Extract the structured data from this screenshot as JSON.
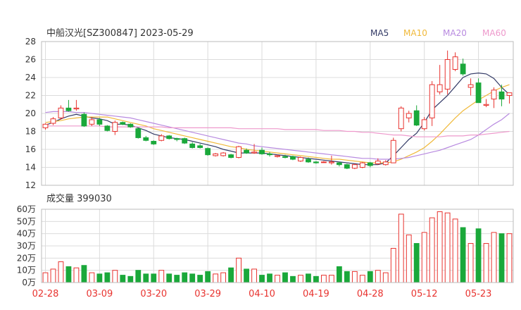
{
  "header": {
    "stock_title": "中船汉光[SZ300847] 2023-05-29",
    "volume_title": "成交量 399030"
  },
  "legend": [
    {
      "label": "MA5",
      "color": "#333a66"
    },
    {
      "label": "MA10",
      "color": "#f0b93a"
    },
    {
      "label": "MA20",
      "color": "#b88ae0"
    },
    {
      "label": "MA60",
      "color": "#ee99cc"
    }
  ],
  "colors": {
    "up": "#e8332f",
    "down": "#1aa83a",
    "grid": "#dcdcdc",
    "axis": "#666666"
  },
  "chart_data": [
    {
      "type": "candlestick",
      "x": [
        "02-28",
        "03-01",
        "03-02",
        "03-03",
        "03-06",
        "03-07",
        "03-08",
        "03-09",
        "03-10",
        "03-13",
        "03-14",
        "03-15",
        "03-16",
        "03-17",
        "03-20",
        "03-21",
        "03-22",
        "03-23",
        "03-24",
        "03-27",
        "03-28",
        "03-29",
        "03-30",
        "03-31",
        "04-03",
        "04-04",
        "04-06",
        "04-07",
        "04-10",
        "04-11",
        "04-12",
        "04-13",
        "04-14",
        "04-17",
        "04-18",
        "04-19",
        "04-20",
        "04-21",
        "04-24",
        "04-25",
        "04-26",
        "04-27",
        "04-28",
        "05-04",
        "05-05",
        "05-08",
        "05-09",
        "05-10",
        "05-11",
        "05-12",
        "05-15",
        "05-16",
        "05-17",
        "05-18",
        "05-19",
        "05-22",
        "05-23",
        "05-24",
        "05-25",
        "05-26",
        "05-29"
      ],
      "x_tick_labels": [
        "02-28",
        "03-09",
        "03-20",
        "03-29",
        "04-10",
        "04-19",
        "04-28",
        "05-12",
        "05-23"
      ],
      "ohlc": [
        [
          18.4,
          18.9,
          18.2,
          18.8
        ],
        [
          18.9,
          19.6,
          18.7,
          19.4
        ],
        [
          19.5,
          20.9,
          19.3,
          20.6
        ],
        [
          20.6,
          21.5,
          20.2,
          20.3
        ],
        [
          20.5,
          21.5,
          20.3,
          20.6
        ],
        [
          19.9,
          20.1,
          18.5,
          18.6
        ],
        [
          18.8,
          19.6,
          18.6,
          19.3
        ],
        [
          19.3,
          19.5,
          18.6,
          18.8
        ],
        [
          18.6,
          18.7,
          18.0,
          18.1
        ],
        [
          18.0,
          19.2,
          17.6,
          19.0
        ],
        [
          19.0,
          19.1,
          18.7,
          18.8
        ],
        [
          18.8,
          18.9,
          18.4,
          18.5
        ],
        [
          18.3,
          18.4,
          17.2,
          17.3
        ],
        [
          17.3,
          17.5,
          16.9,
          17.0
        ],
        [
          16.9,
          17.0,
          16.5,
          16.6
        ],
        [
          17.0,
          17.7,
          16.9,
          17.5
        ],
        [
          17.5,
          17.6,
          17.1,
          17.2
        ],
        [
          17.2,
          17.3,
          16.9,
          17.1
        ],
        [
          17.2,
          17.3,
          16.6,
          16.7
        ],
        [
          16.6,
          16.8,
          16.1,
          16.2
        ],
        [
          16.4,
          16.6,
          16.1,
          16.2
        ],
        [
          16.1,
          16.2,
          15.3,
          15.4
        ],
        [
          15.3,
          15.6,
          15.2,
          15.5
        ],
        [
          15.3,
          15.7,
          15.2,
          15.6
        ],
        [
          15.4,
          15.5,
          15.0,
          15.1
        ],
        [
          15.1,
          16.4,
          15.0,
          16.3
        ],
        [
          15.9,
          16.1,
          15.5,
          15.6
        ],
        [
          15.6,
          16.6,
          15.5,
          15.7
        ],
        [
          15.9,
          16.2,
          15.4,
          15.5
        ],
        [
          15.5,
          15.7,
          15.2,
          15.4
        ],
        [
          15.2,
          15.4,
          15.1,
          15.3
        ],
        [
          15.2,
          15.4,
          15.0,
          15.1
        ],
        [
          15.2,
          15.3,
          14.8,
          14.9
        ],
        [
          14.7,
          15.2,
          14.6,
          15.1
        ],
        [
          14.9,
          15.1,
          14.5,
          14.6
        ],
        [
          14.6,
          14.7,
          14.4,
          14.5
        ],
        [
          14.6,
          14.7,
          14.5,
          14.6
        ],
        [
          14.5,
          15.3,
          14.3,
          14.6
        ],
        [
          14.5,
          14.6,
          14.1,
          14.3
        ],
        [
          14.3,
          14.4,
          13.8,
          13.9
        ],
        [
          13.9,
          14.4,
          13.8,
          14.3
        ],
        [
          14.0,
          14.6,
          13.9,
          14.5
        ],
        [
          14.5,
          14.6,
          14.0,
          14.2
        ],
        [
          14.4,
          15.0,
          14.3,
          14.7
        ],
        [
          14.3,
          14.8,
          14.2,
          14.6
        ],
        [
          14.5,
          17.3,
          14.5,
          17.0
        ],
        [
          18.3,
          20.8,
          18.0,
          20.6
        ],
        [
          19.5,
          20.3,
          19.0,
          20.0
        ],
        [
          20.3,
          20.9,
          18.6,
          18.7
        ],
        [
          18.3,
          19.6,
          18.1,
          19.3
        ],
        [
          19.5,
          23.6,
          18.6,
          23.2
        ],
        [
          22.4,
          25.4,
          22.1,
          23.2
        ],
        [
          22.7,
          27.0,
          22.1,
          26.0
        ],
        [
          24.9,
          26.8,
          24.7,
          26.3
        ],
        [
          25.5,
          26.1,
          24.2,
          24.4
        ],
        [
          22.9,
          23.9,
          22.0,
          23.2
        ],
        [
          23.4,
          23.9,
          21.8,
          21.2
        ],
        [
          20.9,
          21.6,
          20.7,
          21.0
        ],
        [
          21.6,
          22.9,
          20.6,
          22.6
        ],
        [
          22.4,
          23.2,
          20.8,
          21.6
        ],
        [
          22.0,
          22.1,
          21.1,
          22.3
        ]
      ],
      "ma": {
        "MA5": [
          18.7,
          19.0,
          19.4,
          19.7,
          19.9,
          19.7,
          19.5,
          19.4,
          19.2,
          18.8,
          18.8,
          18.7,
          18.4,
          18.1,
          17.7,
          17.5,
          17.3,
          17.2,
          17.1,
          16.9,
          16.7,
          16.5,
          16.3,
          16.0,
          15.8,
          15.6,
          15.6,
          15.6,
          15.6,
          15.5,
          15.4,
          15.3,
          15.2,
          15.1,
          15.0,
          14.9,
          14.8,
          14.7,
          14.6,
          14.5,
          14.4,
          14.3,
          14.3,
          14.3,
          14.5,
          15.3,
          16.2,
          17.1,
          17.8,
          19.0,
          20.4,
          21.2,
          22.0,
          23.0,
          24.0,
          24.4,
          24.5,
          24.4,
          23.9,
          22.9,
          22.1
        ],
        "MA10": [
          19.0,
          19.1,
          19.2,
          19.4,
          19.5,
          19.6,
          19.6,
          19.6,
          19.6,
          19.4,
          19.2,
          19.0,
          18.8,
          18.6,
          18.3,
          18.1,
          17.9,
          17.7,
          17.5,
          17.3,
          17.1,
          16.9,
          16.7,
          16.5,
          16.3,
          16.2,
          16.0,
          15.9,
          15.8,
          15.7,
          15.6,
          15.5,
          15.4,
          15.3,
          15.2,
          15.1,
          15.0,
          14.9,
          14.9,
          14.8,
          14.7,
          14.6,
          14.5,
          14.5,
          14.5,
          14.6,
          14.9,
          15.3,
          15.7,
          16.2,
          16.9,
          17.7,
          18.6,
          19.5,
          20.3,
          20.9,
          21.5,
          22.0,
          22.5,
          22.9,
          23.2
        ],
        "MA20": [
          20.1,
          20.2,
          20.2,
          20.2,
          20.1,
          20.1,
          20.0,
          19.9,
          19.8,
          19.7,
          19.6,
          19.5,
          19.3,
          19.1,
          18.9,
          18.7,
          18.5,
          18.3,
          18.1,
          17.9,
          17.7,
          17.5,
          17.3,
          17.1,
          16.9,
          16.7,
          16.6,
          16.4,
          16.3,
          16.2,
          16.1,
          16.0,
          15.9,
          15.8,
          15.7,
          15.6,
          15.5,
          15.4,
          15.3,
          15.2,
          15.1,
          15.0,
          15.0,
          14.9,
          14.9,
          14.9,
          15.0,
          15.1,
          15.3,
          15.5,
          15.7,
          15.9,
          16.2,
          16.5,
          16.8,
          17.1,
          17.6,
          18.2,
          18.8,
          19.3,
          20.0
        ],
        "MA60": [
          18.6,
          18.6,
          18.6,
          18.6,
          18.6,
          18.6,
          18.6,
          18.6,
          18.5,
          18.5,
          18.5,
          18.5,
          18.5,
          18.5,
          18.5,
          18.5,
          18.4,
          18.4,
          18.4,
          18.4,
          18.4,
          18.4,
          18.4,
          18.4,
          18.4,
          18.3,
          18.3,
          18.3,
          18.3,
          18.3,
          18.3,
          18.2,
          18.2,
          18.2,
          18.2,
          18.2,
          18.1,
          18.1,
          18.1,
          18.0,
          18.0,
          17.9,
          17.9,
          17.8,
          17.7,
          17.6,
          17.6,
          17.5,
          17.4,
          17.4,
          17.4,
          17.4,
          17.5,
          17.5,
          17.5,
          17.6,
          17.6,
          17.7,
          17.8,
          17.9,
          18.0
        ]
      },
      "y_ticks": [
        12,
        14,
        16,
        18,
        20,
        22,
        24,
        26,
        28
      ],
      "ylim": [
        12,
        28
      ]
    },
    {
      "type": "bar",
      "x_ref": "same as candlestick x",
      "values": [
        8,
        11,
        17,
        13,
        12,
        14,
        8,
        7,
        8,
        10,
        6,
        5,
        10,
        7,
        7,
        10,
        7,
        6,
        8,
        7,
        6,
        9,
        7,
        8,
        12,
        20,
        11,
        11,
        6,
        7,
        6,
        8,
        5,
        6,
        7,
        5,
        6,
        6,
        13,
        9,
        9,
        6,
        9,
        10,
        8,
        28,
        56,
        39,
        32,
        41,
        53,
        58,
        57,
        52,
        45,
        32,
        44,
        32,
        41,
        40,
        40
      ],
      "y_ticks": [
        "0万",
        "10万",
        "20万",
        "30万",
        "40万",
        "50万",
        "60万"
      ],
      "ylim": [
        0,
        60
      ]
    }
  ]
}
